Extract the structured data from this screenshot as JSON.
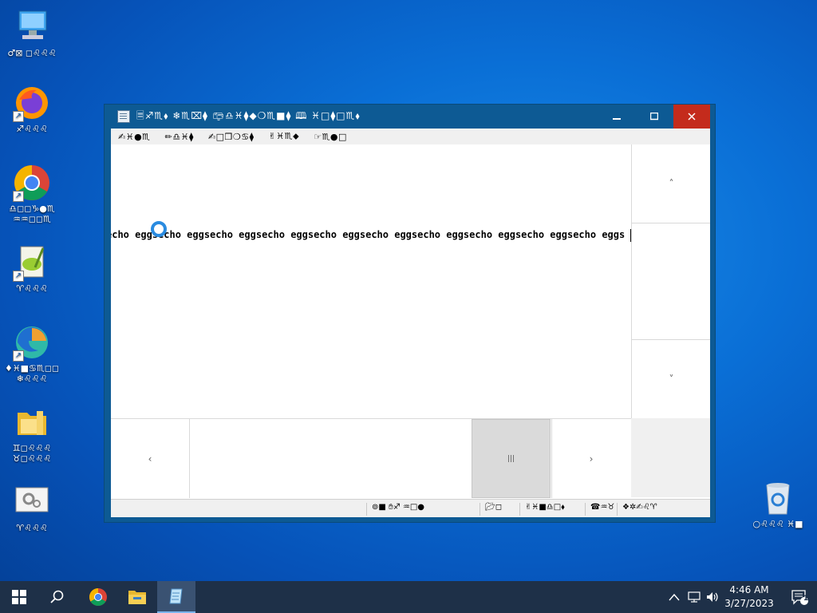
{
  "desktop": {
    "icons": [
      {
        "label": "♂⊠ ◻︎♌︎♌︎♌︎"
      },
      {
        "label": "♐︎♌︎♌︎♌︎"
      },
      {
        "label": "♎︎◻︎◻︎♑︎●♏︎ ♒︎♒︎◻︎◻︎♏︎"
      },
      {
        "label": "♈︎♌︎♌︎♌︎"
      },
      {
        "label": "♦︎♓︎■♋︎♏︎◻︎◻︎ ❄︎♌︎♌︎♌︎"
      },
      {
        "label": "♊︎◻︎♌︎♌︎♌︎ ♉︎◻︎♌︎♌︎♌︎"
      },
      {
        "label": "♈︎♌︎♌︎♌︎"
      },
      {
        "label": "○♌︎♌︎♌︎ ♓︎■"
      }
    ]
  },
  "window": {
    "title": "🗏︎♐︎♏︎⬧︎ ❄︎♏︎⌧︎⧫︎ 📪︎♎︎♓︎⧫︎◆︎❍︎♏︎■⧫︎ 🕮︎ ♓︎□⧫︎□♏︎⬧︎",
    "menu": [
      "✍︎♓︎●♏︎",
      "✏︎♎︎♓︎⧫︎",
      "✍︎□❒︎❍︎♋︎⧫︎",
      "✌︎♓︎♏︎⬥︎",
      "☞︎♏︎●□"
    ],
    "minimize": "🗕",
    "maximize": "🗖",
    "close": "✕",
    "text_line": "echo eggsecho eggsecho eggsecho eggsecho eggsecho eggsecho eggsecho eggsecho eggsecho eggs",
    "scroll_up": "˄",
    "scroll_down": "˅",
    "scroll_left": "‹",
    "scroll_right": "›",
    "thumb_grip": "|||",
    "status": {
      "seg1": "⊚■ ✋︎♐︎ ♒︎□● ",
      "seg2": "📂︎◻︎",
      "seg3": "✌︎♓︎■♎︎□⬧︎",
      "seg4": "☎︎♒︎♉︎",
      "seg5": "❖✲✍︎♌︎♈︎"
    }
  },
  "taskbar": {
    "time": "4:46 AM",
    "date": "3/27/2023",
    "notification_count": "1"
  }
}
